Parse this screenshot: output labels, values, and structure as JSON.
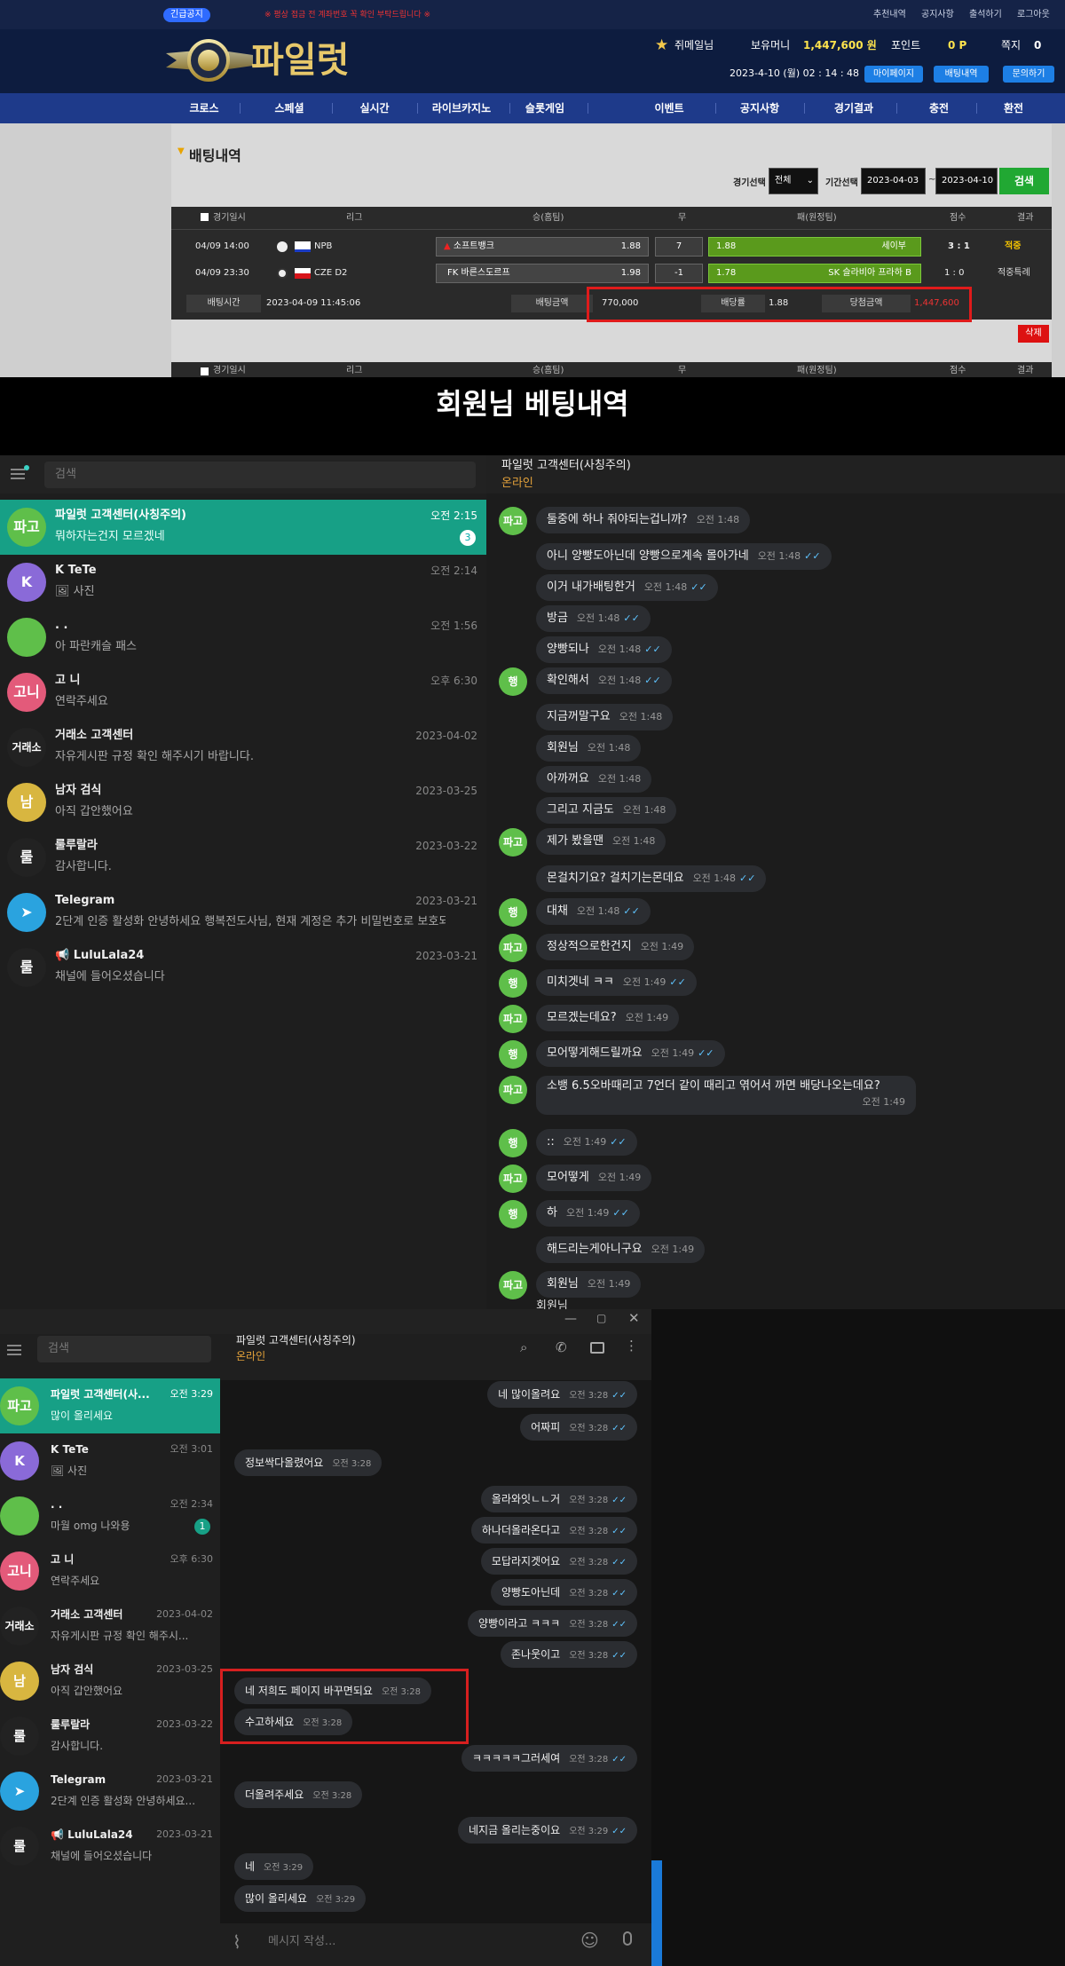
{
  "site": {
    "notice_badge": "긴급공지",
    "notice_text": "※ 평상 접금 전 계좌번호 꼭 확인 부탁드립니다 ※",
    "top_links": [
      "추천내역",
      "공지사항",
      "출석하기",
      "로그아웃"
    ],
    "logo_text": "파일럿",
    "user_name": "쥐메일님",
    "balance_label": "보유머니",
    "balance_value": "1,447,600 원",
    "points_label": "포인트",
    "points_value": "0 P",
    "notes_label": "쪽지",
    "notes_value": "0",
    "datetime": "2023-4-10 (월) 02 : 14 : 48",
    "header_buttons": [
      "마이페이지",
      "배팅내역",
      "문의하기"
    ],
    "nav": [
      "크로스",
      "스페셜",
      "실시간",
      "라이브카지노",
      "슬롯게임",
      "이벤트",
      "공지사항",
      "경기결과",
      "충전",
      "환전"
    ],
    "section_title": "배팅내역",
    "filter": {
      "game_label": "경기선택",
      "game_value": "전체",
      "period_label": "기간선택",
      "date_from": "2023-04-03",
      "date_sep": "~",
      "date_to": "2023-04-10",
      "search_label": "검색"
    },
    "table_headers": [
      "경기일시",
      "리그",
      "승(홈팀)",
      "무",
      "패(원정팀)",
      "점수",
      "결과"
    ],
    "rows": [
      {
        "date": "04/09 14:00",
        "league": "NPB",
        "home": "소프트뱅크",
        "home_odds": "1.88",
        "draw": "7",
        "away_odds": "1.88",
        "away": "세이부",
        "score": "3 : 1",
        "result": "적중"
      },
      {
        "date": "04/09 23:30",
        "league": "CZE D2",
        "home": "FK 바른스도르프",
        "home_odds": "1.98",
        "draw": "-1",
        "away_odds": "1.78",
        "away": "SK 슬라비아 프라하 B",
        "score": "1 : 0",
        "result": "적중특례"
      }
    ],
    "summary": {
      "bet_time_label": "배팅시간",
      "bet_time": "2023-04-09 11:45:06",
      "bet_amount_label": "배팅금액",
      "bet_amount": "770,000",
      "odds_label": "배당률",
      "odds": "1.88",
      "win_label": "당첨금액",
      "win_amount": "1,447,600"
    },
    "delete_label": "삭제"
  },
  "title_band": "회원님 베팅내역",
  "tg1": {
    "search_placeholder": "검색",
    "chat_title": "파일럿 고객센터(사칭주의)",
    "chat_status": "온라인",
    "chats": [
      {
        "avatar": "파고",
        "color": "#5fbf4a",
        "name": "파일럿 고객센터(사칭주의)",
        "time": "오전 2:15",
        "msg": "뭐하자는건지 모르겠네",
        "badge": "3"
      },
      {
        "avatar": "K",
        "color": "#8a6ad8",
        "name": "K TeTe",
        "time": "오전 2:14",
        "msg": "🖼 사진",
        "badge": ""
      },
      {
        "avatar": "",
        "color": "#5fbf4a",
        "name": ". .",
        "time": "오전 1:56",
        "msg": "아 파란캐슬 패스",
        "badge": ""
      },
      {
        "avatar": "고니",
        "color": "#e35a7a",
        "name": "고 니",
        "time": "오후 6:30",
        "msg": "연락주세요",
        "badge": ""
      },
      {
        "avatar": "거래소",
        "color": "#222222",
        "name": "거래소 고객센터",
        "time": "2023-04-02",
        "msg": "자유게시판 규정 확인 해주시기 바랍니다.",
        "badge": ""
      },
      {
        "avatar": "남",
        "color": "#d8b640",
        "name": "남자 검식",
        "time": "2023-03-25",
        "msg": "아직 갑안했어요",
        "badge": ""
      },
      {
        "avatar": "룰",
        "color": "#222222",
        "name": "룰루랄라",
        "time": "2023-03-22",
        "msg": "감사합니다.",
        "badge": ""
      },
      {
        "avatar": "➤",
        "color": "#2aa3df",
        "name": "Telegram",
        "time": "2023-03-21",
        "msg": "2단계 인증 활성화 안녕하세요 행복전도사님, 현재 계정은 추가 비밀번호로 보호되...",
        "badge": ""
      },
      {
        "avatar": "룰",
        "color": "#222222",
        "name": "📢 LuluLala24",
        "time": "2023-03-21",
        "msg": "채널에 들어오셨습니다",
        "badge": ""
      }
    ],
    "messages": [
      {
        "side": "in",
        "av": "파고",
        "text": "둘중에 하나 줘야되는겁니까?",
        "time": "오전 1:48"
      },
      {
        "side": "in",
        "av": "",
        "text": "아니 양빵도아닌데 양빵으로계속 몰아가네",
        "time": "오전 1:48",
        "check": true
      },
      {
        "side": "in",
        "av": "",
        "text": "이거 내가배팅한거",
        "time": "오전 1:48",
        "check": true
      },
      {
        "side": "in",
        "av": "",
        "text": "방금",
        "time": "오전 1:48",
        "check": true
      },
      {
        "side": "in",
        "av": "",
        "text": "양빵되나",
        "time": "오전 1:48",
        "check": true
      },
      {
        "side": "in",
        "av": "행",
        "text": "확인해서",
        "time": "오전 1:48",
        "check": true
      },
      {
        "side": "in",
        "av": "",
        "text": "지금꺼말구요",
        "time": "오전 1:48"
      },
      {
        "side": "in",
        "av": "",
        "text": "회원님",
        "time": "오전 1:48"
      },
      {
        "side": "in",
        "av": "",
        "text": "아까꺼요",
        "time": "오전 1:48"
      },
      {
        "side": "in",
        "av": "",
        "text": "그리고 지금도",
        "time": "오전 1:48"
      },
      {
        "side": "in",
        "av": "파고",
        "text": "제가 봤을땐",
        "time": "오전 1:48"
      },
      {
        "side": "in",
        "av": "",
        "text": "몬걸치기요? 걸치기는몬데요",
        "time": "오전 1:48",
        "check": true
      },
      {
        "side": "in",
        "av": "행",
        "text": "대채",
        "time": "오전 1:48",
        "check": true
      },
      {
        "side": "in",
        "av": "파고",
        "text": "정상적으로한건지",
        "time": "오전 1:49"
      },
      {
        "side": "in",
        "av": "행",
        "text": "미치겟네 ㅋㅋ",
        "time": "오전 1:49",
        "check": true
      },
      {
        "side": "in",
        "av": "파고",
        "text": "모르겠는데요?",
        "time": "오전 1:49"
      },
      {
        "side": "in",
        "av": "행",
        "text": "모어떻게해드릴까요",
        "time": "오전 1:49",
        "check": true
      },
      {
        "side": "in",
        "av": "파고",
        "text": "소뱅 6.5오바때리고 7언더 같이 때리고 엮어서 까면 배당나오는데요?",
        "time": "오전 1:49",
        "two_line": true
      },
      {
        "side": "in",
        "av": "행",
        "text": "::",
        "time": "오전 1:49",
        "check": true
      },
      {
        "side": "in",
        "av": "파고",
        "text": "모어떻게",
        "time": "오전 1:49"
      },
      {
        "side": "in",
        "av": "행",
        "text": "하",
        "time": "오전 1:49",
        "check": true
      },
      {
        "side": "in",
        "av": "",
        "text": "해드리는게아니구요",
        "time": "오전 1:49"
      },
      {
        "side": "in",
        "av": "파고",
        "text": "회원님",
        "time": "오전 1:49"
      }
    ],
    "cut_text": "회원님"
  },
  "tg2": {
    "search_placeholder": "검색",
    "chat_title": "파일럿 고객센터(사칭주의)",
    "chat_status": "온라인",
    "compose_placeholder": "메시지 작성...",
    "chats": [
      {
        "avatar": "파고",
        "color": "#5fbf4a",
        "name": "파일럿 고객센터(사...",
        "time": "오전 3:29",
        "msg": "많이 올리세요",
        "badge": ""
      },
      {
        "avatar": "K",
        "color": "#8a6ad8",
        "name": "K TeTe",
        "time": "오전 3:01",
        "msg": "🖼 사진",
        "badge": ""
      },
      {
        "avatar": "",
        "color": "#5fbf4a",
        "name": ". .",
        "time": "오전 2:34",
        "msg": "마월 omg 나와용",
        "badge": "1"
      },
      {
        "avatar": "고니",
        "color": "#e35a7a",
        "name": "고 니",
        "time": "오후 6:30",
        "msg": "연락주세요",
        "badge": ""
      },
      {
        "avatar": "거래소",
        "color": "#222222",
        "name": "거래소 고객센터",
        "time": "2023-04-02",
        "msg": "자유게시판 규정 확인 해주시...",
        "badge": ""
      },
      {
        "avatar": "남",
        "color": "#d8b640",
        "name": "남자 검식",
        "time": "2023-03-25",
        "msg": "아직 갑안했어요",
        "badge": ""
      },
      {
        "avatar": "룰",
        "color": "#222222",
        "name": "룰루랄라",
        "time": "2023-03-22",
        "msg": "감사합니다.",
        "badge": ""
      },
      {
        "avatar": "➤",
        "color": "#2aa3df",
        "name": "Telegram",
        "time": "2023-03-21",
        "msg": "2단계 인증 활성화 안녕하세요...",
        "badge": ""
      },
      {
        "avatar": "룰",
        "color": "#222222",
        "name": "📢 LuluLala24",
        "time": "2023-03-21",
        "msg": "채널에 들어오셨습니다",
        "badge": ""
      }
    ],
    "messages": [
      {
        "side": "out",
        "text": "네 많이올려요",
        "time": "오전 3:28"
      },
      {
        "side": "out",
        "text": "어짜피",
        "time": "오전 3:28"
      },
      {
        "side": "in",
        "text": "정보싹다올렸어요",
        "time": "오전 3:28"
      },
      {
        "side": "out",
        "text": "올라와잇ㄴㄴ거",
        "time": "오전 3:28"
      },
      {
        "side": "out",
        "text": "하나더올라온다고",
        "time": "오전 3:28"
      },
      {
        "side": "out",
        "text": "모답라지겟어요",
        "time": "오전 3:28"
      },
      {
        "side": "out",
        "text": "양빵도아닌데",
        "time": "오전 3:28"
      },
      {
        "side": "out",
        "text": "양빵이라고 ㅋㅋㅋ",
        "time": "오전 3:28"
      },
      {
        "side": "out",
        "text": "존나웃이고",
        "time": "오전 3:28"
      },
      {
        "side": "in",
        "text": "네 저희도 페이지 바꾸면되요",
        "time": "오전 3:28"
      },
      {
        "side": "in",
        "text": "수고하세요",
        "time": "오전 3:28"
      },
      {
        "side": "out",
        "text": "ㅋㅋㅋㅋㅋ그러세여",
        "time": "오전 3:28"
      },
      {
        "side": "in",
        "text": "더올려주세요",
        "time": "오전 3:28"
      },
      {
        "side": "out",
        "text": "네지금 올리는중이요",
        "time": "오전 3:29"
      },
      {
        "side": "in",
        "text": "네",
        "time": "오전 3:29"
      },
      {
        "side": "in",
        "text": "많이 올리세요",
        "time": "오전 3:29"
      }
    ]
  }
}
